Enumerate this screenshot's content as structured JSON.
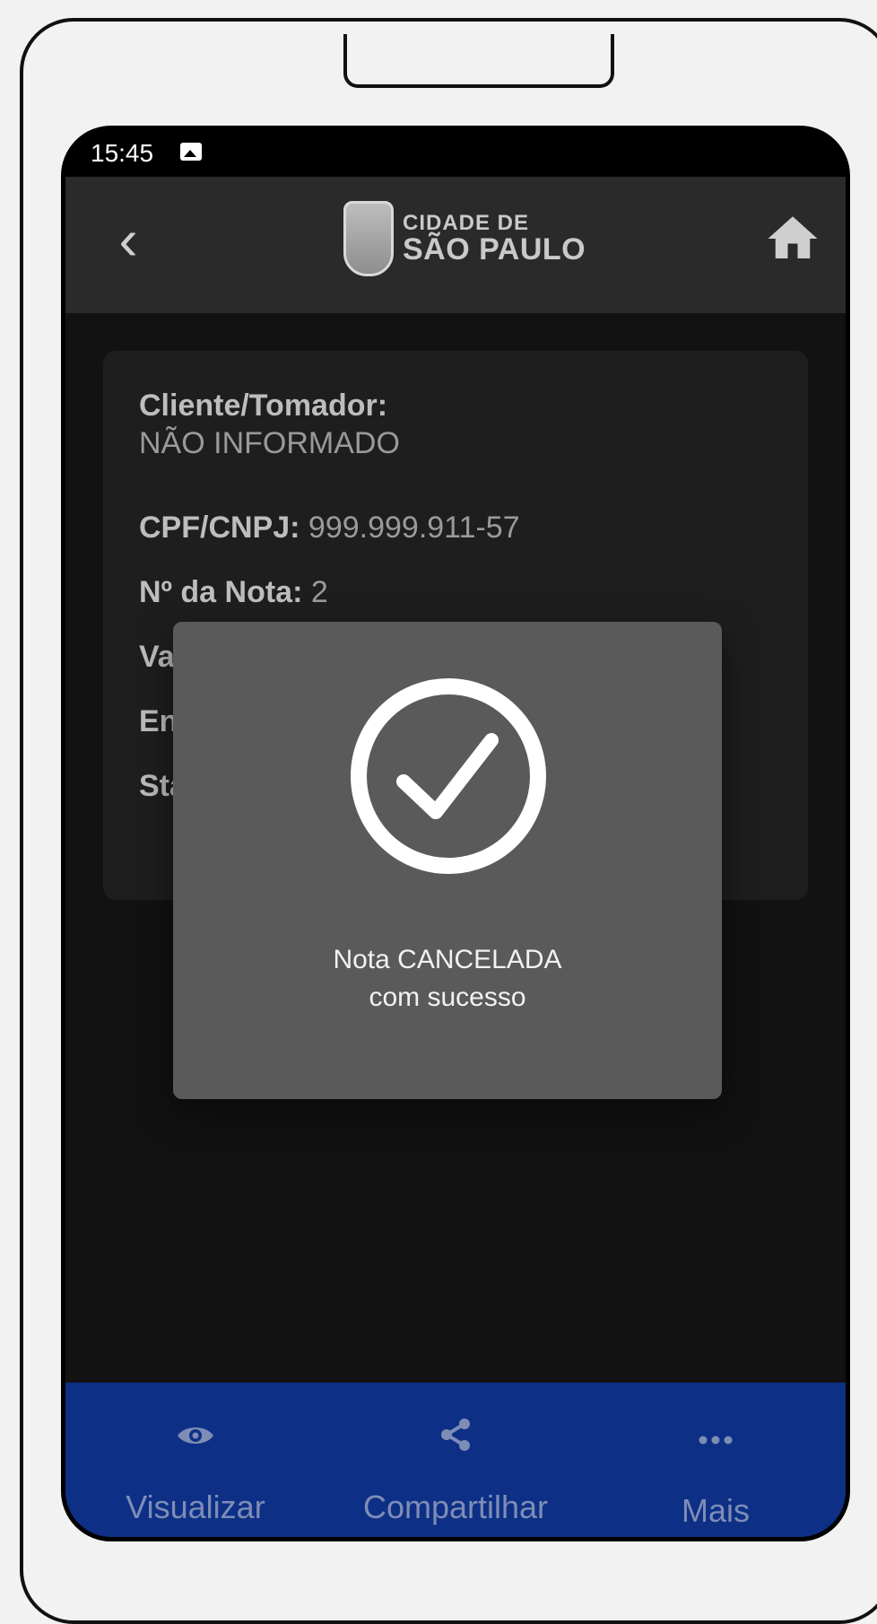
{
  "status_bar": {
    "time": "15:45"
  },
  "header": {
    "logo_line1": "CIDADE DE",
    "logo_line2": "SÃO PAULO"
  },
  "card": {
    "cliente_label": "Cliente/Tomador:",
    "cliente_value": "NÃO INFORMADO",
    "cpf_label": "CPF/CNPJ:",
    "cpf_value": "999.999.911-57",
    "nota_label": "Nº da Nota:",
    "nota_value": "2",
    "valor_partial": "Va",
    "emissao_partial": "En",
    "status_partial": "Sta"
  },
  "modal": {
    "message_line1": "Nota CANCELADA",
    "message_line2": "com sucesso"
  },
  "bottom_nav": {
    "items": [
      {
        "label": "Visualizar",
        "icon": "eye-icon"
      },
      {
        "label": "Compartilhar",
        "icon": "share-icon"
      },
      {
        "label": "Mais",
        "icon": "more-icon"
      }
    ]
  },
  "colors": {
    "bottom_nav": "#0d2f86",
    "screen_bg": "#121212",
    "modal_bg": "#5a5a5a"
  }
}
